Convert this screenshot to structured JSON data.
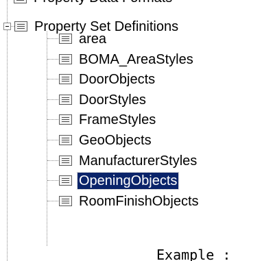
{
  "tree": {
    "partial_top_label": "Property Data Formats",
    "parent": {
      "label": "Property Set Definitions",
      "icon": "list-icon",
      "expanded": true
    },
    "children": [
      {
        "label": "area",
        "icon": "list-icon",
        "selected": false
      },
      {
        "label": "BOMA_AreaStyles",
        "icon": "list-icon",
        "selected": false
      },
      {
        "label": "DoorObjects",
        "icon": "list-icon",
        "selected": false
      },
      {
        "label": "DoorStyles",
        "icon": "list-icon",
        "selected": false
      },
      {
        "label": "FrameStyles",
        "icon": "list-icon",
        "selected": false
      },
      {
        "label": "GeoObjects",
        "icon": "list-icon",
        "selected": false
      },
      {
        "label": "ManufacturerStyles",
        "icon": "list-icon",
        "selected": false
      },
      {
        "label": "OpeningObjects",
        "icon": "list-icon",
        "selected": true
      },
      {
        "label": "RoomFinishObjects",
        "icon": "list-icon",
        "selected": false
      }
    ]
  },
  "partial_bottom_text": "Example :",
  "colors": {
    "selection_background": "#0a246a",
    "selection_text": "#ffffff",
    "tree_lines": "#8a8a8a"
  }
}
